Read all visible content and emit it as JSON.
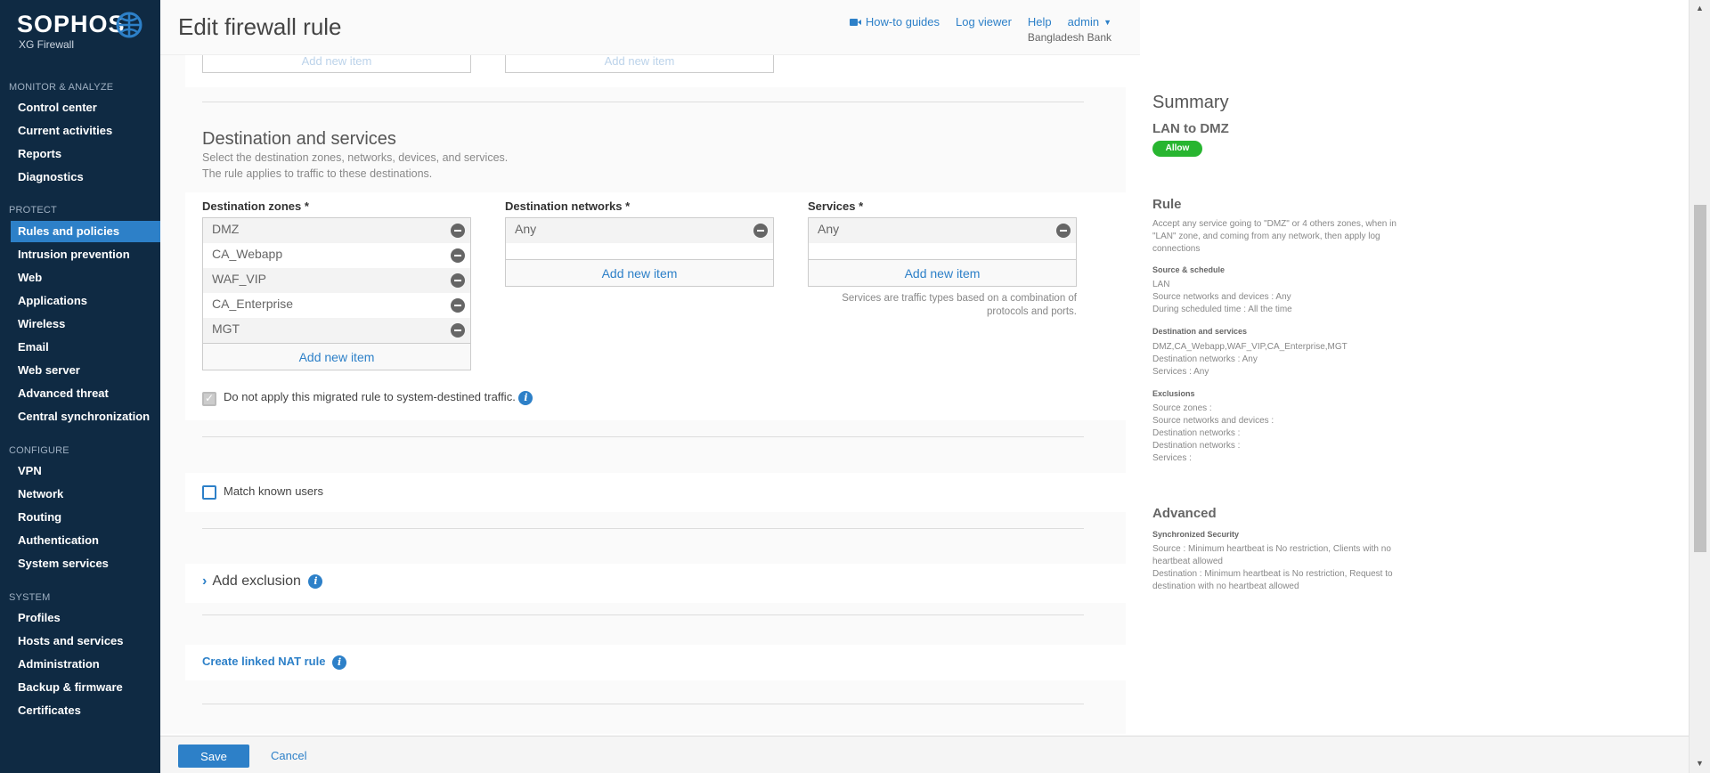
{
  "brand": {
    "name": "SOPHOS",
    "product": "XG Firewall"
  },
  "sidebar": {
    "sections": [
      {
        "title": "MONITOR & ANALYZE",
        "items": [
          "Control center",
          "Current activities",
          "Reports",
          "Diagnostics"
        ]
      },
      {
        "title": "PROTECT",
        "items": [
          "Rules and policies",
          "Intrusion prevention",
          "Web",
          "Applications",
          "Wireless",
          "Email",
          "Web server",
          "Advanced threat",
          "Central synchronization"
        ]
      },
      {
        "title": "CONFIGURE",
        "items": [
          "VPN",
          "Network",
          "Routing",
          "Authentication",
          "System services"
        ]
      },
      {
        "title": "SYSTEM",
        "items": [
          "Profiles",
          "Hosts and services",
          "Administration",
          "Backup & firmware",
          "Certificates"
        ]
      }
    ],
    "active_item": "Rules and policies"
  },
  "header": {
    "title": "Edit firewall rule",
    "links": {
      "guides": "How-to guides",
      "log_viewer": "Log viewer",
      "help": "Help",
      "user": "admin"
    },
    "org": "Bangladesh Bank"
  },
  "top_stub": {
    "add_left": "Add new item",
    "add_right": "Add new item"
  },
  "destination": {
    "title": "Destination and services",
    "desc1": "Select the destination zones, networks, devices, and services.",
    "desc2": "The rule applies to traffic to these destinations.",
    "zones_label": "Destination zones *",
    "zones": [
      "DMZ",
      "CA_Webapp",
      "WAF_VIP",
      "CA_Enterprise",
      "MGT"
    ],
    "networks_label": "Destination networks *",
    "networks": [
      "Any"
    ],
    "services_label": "Services *",
    "services": [
      "Any"
    ],
    "add_item": "Add new item",
    "services_hint1": "Services are traffic types based on a combination of",
    "services_hint2": "protocols and ports.",
    "migrated_label": "Do not apply this migrated rule to system-destined traffic.",
    "migrated_checked": true
  },
  "match_users": {
    "label": "Match known users",
    "checked": false
  },
  "exclusion": {
    "label": "Add exclusion"
  },
  "nat": {
    "label": "Create linked NAT rule"
  },
  "summary": {
    "title": "Summary",
    "rule_name": "LAN to DMZ",
    "action": "Allow",
    "rule_heading": "Rule",
    "rule_desc": "Accept any service going to \"DMZ\" or 4 others zones, when in \"LAN\" zone, and coming from any network, then apply log connections",
    "source_heading": "Source & schedule",
    "source_lines": [
      "LAN",
      "Source networks and devices : Any",
      "During scheduled time : All the time"
    ],
    "dest_heading": "Destination and services",
    "dest_lines": [
      "DMZ,CA_Webapp,WAF_VIP,CA_Enterprise,MGT",
      "Destination networks : Any",
      "Services : Any"
    ],
    "excl_heading": "Exclusions",
    "excl_lines": [
      "Source zones :",
      "Source networks and devices :",
      "Destination networks :",
      "Destination networks :",
      "Services :"
    ],
    "adv_heading": "Advanced",
    "sync_heading": "Synchronized Security",
    "sync_source": "Source : Minimum heartbeat is No restriction, Clients with no heartbeat allowed",
    "sync_dest": "Destination : Minimum heartbeat is No restriction, Request to destination with no heartbeat allowed"
  },
  "footer": {
    "save": "Save",
    "cancel": "Cancel"
  },
  "colors": {
    "sidebar_bg": "#0f2a43",
    "accent": "#2d80c8",
    "allow_badge": "#28b530"
  }
}
